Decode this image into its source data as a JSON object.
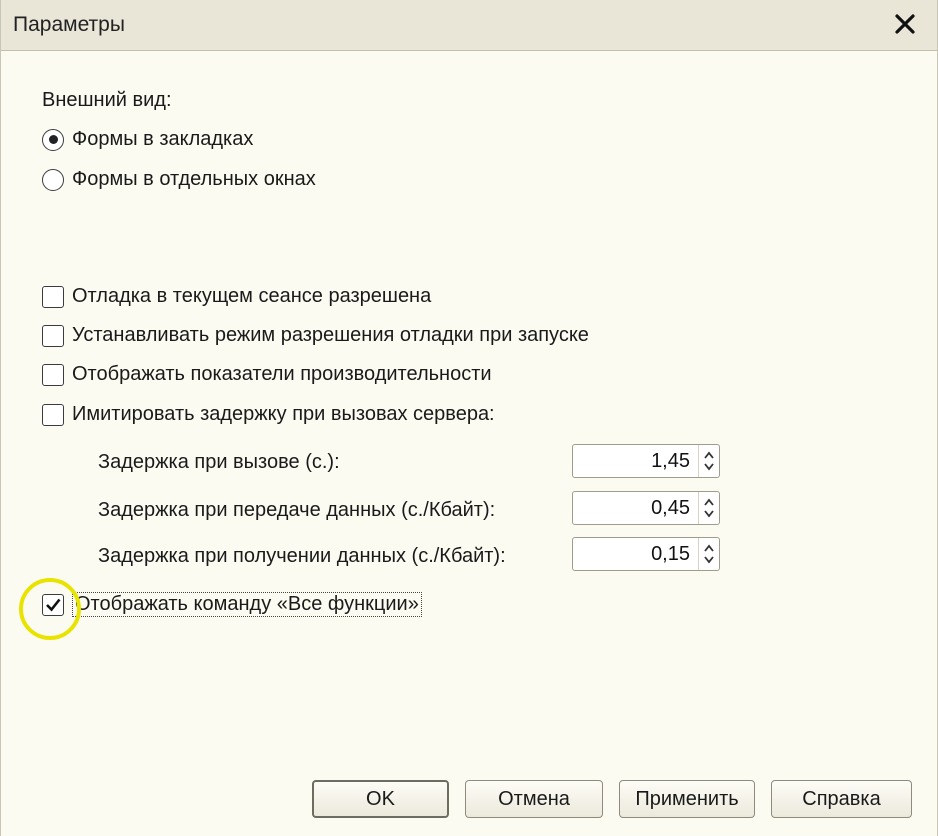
{
  "window": {
    "title": "Параметры"
  },
  "appearance": {
    "label": "Внешний вид:",
    "options": [
      {
        "label": "Формы в закладках",
        "selected": true
      },
      {
        "label": "Формы в отдельных окнах",
        "selected": false
      }
    ]
  },
  "checkboxes": [
    {
      "label": "Отладка в текущем сеансе разрешена",
      "checked": false
    },
    {
      "label": "Устанавливать режим разрешения отладки при запуске",
      "checked": false
    },
    {
      "label": "Отображать показатели производительности",
      "checked": false
    },
    {
      "label": "Имитировать задержку при вызовах сервера:",
      "checked": false
    }
  ],
  "delays": [
    {
      "label": "Задержка при вызове (с.):",
      "value": "1,45"
    },
    {
      "label": "Задержка при передаче данных (с./Кбайт):",
      "value": "0,45"
    },
    {
      "label": "Задержка при получении данных (с./Кбайт):",
      "value": "0,15"
    }
  ],
  "all_functions": {
    "label": "Отображать команду «Все функции»",
    "checked": true
  },
  "buttons": {
    "ok": "OK",
    "cancel": "Отмена",
    "apply": "Применить",
    "help": "Справка"
  },
  "colors": {
    "highlight": "#e9e300",
    "background": "#fcfbf2"
  }
}
